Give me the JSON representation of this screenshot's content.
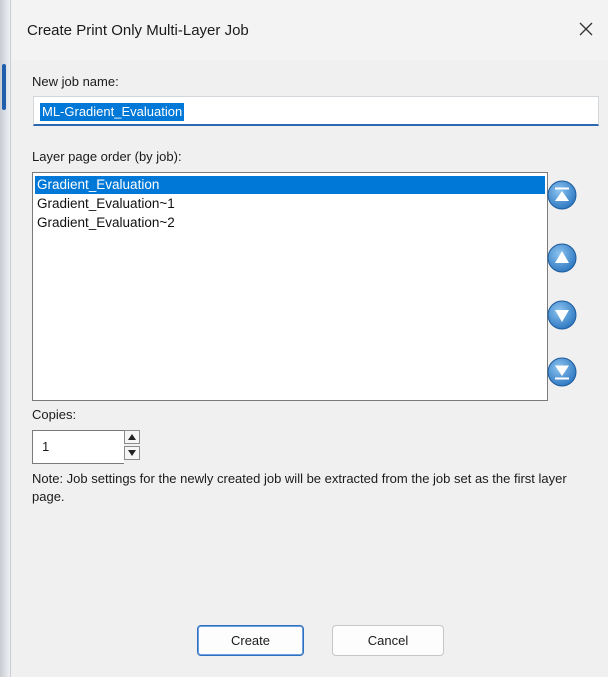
{
  "dialog": {
    "title": "Create Print Only Multi-Layer Job",
    "close_icon": "close-icon"
  },
  "job_name": {
    "label": "New job name:",
    "value": "ML-Gradient_Evaluation"
  },
  "layer_order": {
    "label": "Layer page order (by job):",
    "items": [
      {
        "label": "Gradient_Evaluation",
        "selected": true
      },
      {
        "label": "Gradient_Evaluation~1",
        "selected": false
      },
      {
        "label": "Gradient_Evaluation~2",
        "selected": false
      }
    ],
    "buttons": [
      "move-to-top-icon",
      "move-up-icon",
      "move-down-icon",
      "move-to-bottom-icon"
    ]
  },
  "copies": {
    "label": "Copies:",
    "value": "1"
  },
  "note": "Note: Job settings for the newly created job will be extracted from the job set as the first layer page.",
  "actions": {
    "create": "Create",
    "cancel": "Cancel"
  },
  "colors": {
    "selection": "#0078d7",
    "accent": "#2c68b4",
    "order_button": "#3a86c8"
  }
}
